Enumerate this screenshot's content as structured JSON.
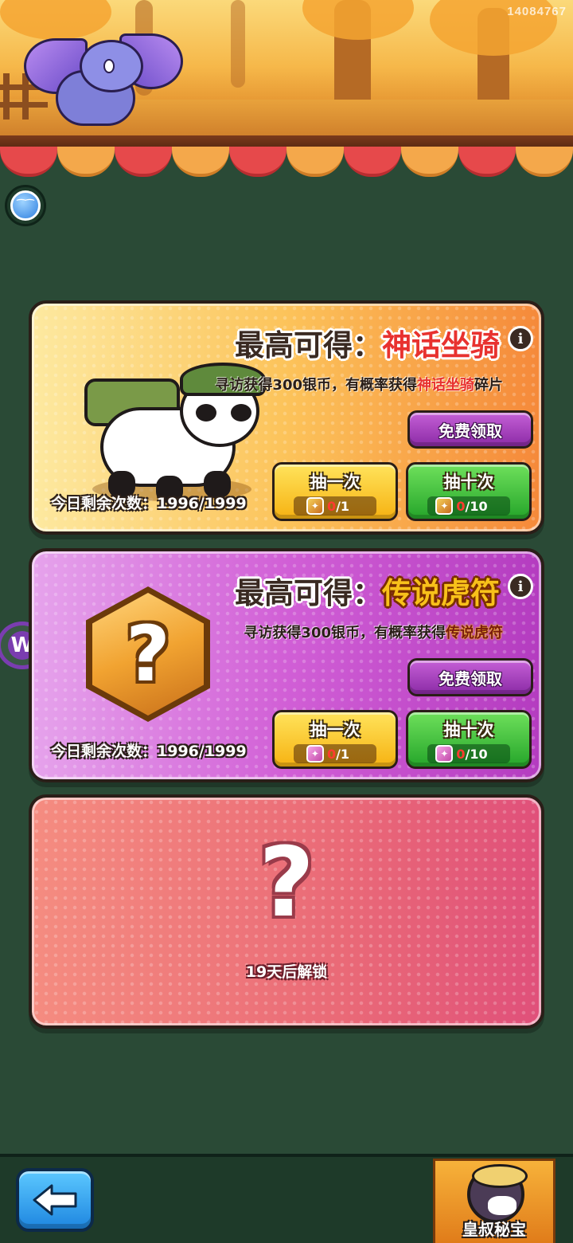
{
  "header": {
    "user_id": "14084767"
  },
  "side": {
    "chat_icon": "chat-face-icon",
    "w_icon": "w-logo-icon",
    "w_letter": "W"
  },
  "cards": [
    {
      "title_label": "最高可得：",
      "title_reward": "神话坐骑",
      "desc_prefix": "寻访获得300银币，有概率获得",
      "desc_highlight": "神话坐骑",
      "desc_suffix": "碎片",
      "remaining": "今日剩余次数：1996/1999",
      "free_label": "免费领取",
      "draw_one": {
        "label": "抽一次",
        "have": "0",
        "need": "/1"
      },
      "draw_ten": {
        "label": "抽十次",
        "have": "0",
        "need": "/10"
      },
      "art": "panda-mount"
    },
    {
      "title_label": "最高可得：",
      "title_reward": "传说虎符",
      "desc_prefix": "寻访获得300银币，有概率获得",
      "desc_highlight": "传说虎符",
      "desc_suffix": "",
      "remaining": "今日剩余次数：1996/1999",
      "free_label": "免费领取",
      "draw_one": {
        "label": "抽一次",
        "have": "0",
        "need": "/1"
      },
      "draw_ten": {
        "label": "抽十次",
        "have": "0",
        "need": "/10"
      },
      "art": "mystery-hexagon"
    },
    {
      "locked": true,
      "question": "?",
      "unlock_text": "19天后解锁"
    }
  ],
  "hex_question": "?",
  "bottom": {
    "back_icon": "back-arrow-icon",
    "treasure_label": "皇叔秘宝"
  },
  "colors": {
    "background": "#2a4a36",
    "card1": "#fcc35a",
    "card2": "#d15fd6",
    "card3": "#ea6a77",
    "free_button": "#8b2ba6",
    "draw_one_button": "#f6b212",
    "draw_ten_button": "#25a52a",
    "highlight_red": "#e8322f"
  }
}
